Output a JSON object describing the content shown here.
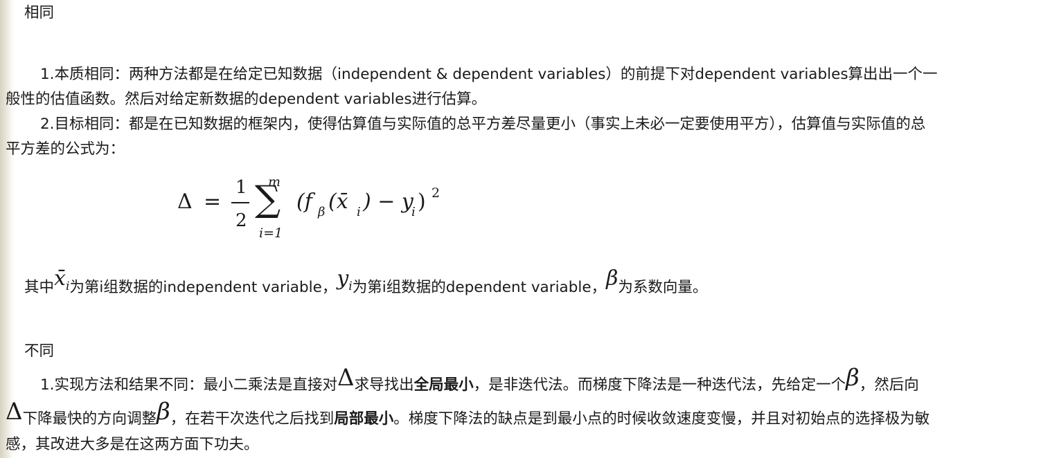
{
  "sections": {
    "same_heading": "相同",
    "same_p1": "1.本质相同：两种方法都是在给定已知数据（independent & dependent variables）的前提下对dependent variables算出出一个一",
    "same_p1_cont": "般性的估值函数。然后对给定新数据的dependent variables进行估算。",
    "same_p2": "2.目标相同：都是在已知数据的框架内，使得估算值与实际值的总平方差尽量更小（事实上未必一定要使用平方），估算值与实际值的总",
    "same_p2_cont": "平方差的公式为：",
    "formula": {
      "delta": "Δ",
      "equals": "=",
      "frac_num": "1",
      "frac_den": "2",
      "sum": "∑",
      "sum_upper": "m",
      "sum_lower": "i=1",
      "body": "(f",
      "sub_beta": "β",
      "paren": "(x̄",
      "sub_i1": "i",
      "minus": ") − y",
      "sub_i2": "i",
      "close": ")",
      "exp": "2"
    },
    "where": {
      "prefix": "其中",
      "x_sym": "x̄",
      "x_sub": "i",
      "x_desc": "为第i组数据的independent variable，",
      "y_sym": "y",
      "y_sub": "i",
      "y_desc": "为第i组数据的dependent variable，",
      "beta_sym": "β",
      "beta_desc": "为系数向量。"
    },
    "diff_heading": "不同",
    "diff_p1": {
      "a": "1.实现方法和结果不同：最小二乘法是直接对",
      "delta1": "Δ",
      "b": "求导找出",
      "bold1": "全局最小",
      "c": "，是非迭代法。而梯度下降法是一种迭代法，先给定一个",
      "beta1": "β",
      "d": "，然后向",
      "delta2": "Δ",
      "e": "下降最快的方向调整",
      "beta2": "β",
      "f": "，在若干次迭代之后找到",
      "bold2": "局部最小",
      "g": "。梯度下降法的缺点是到最小点的时候收敛速度变慢，并且对初始点的选择极为敏",
      "h": "感，其改进大多是在这两方面下功夫。"
    }
  }
}
